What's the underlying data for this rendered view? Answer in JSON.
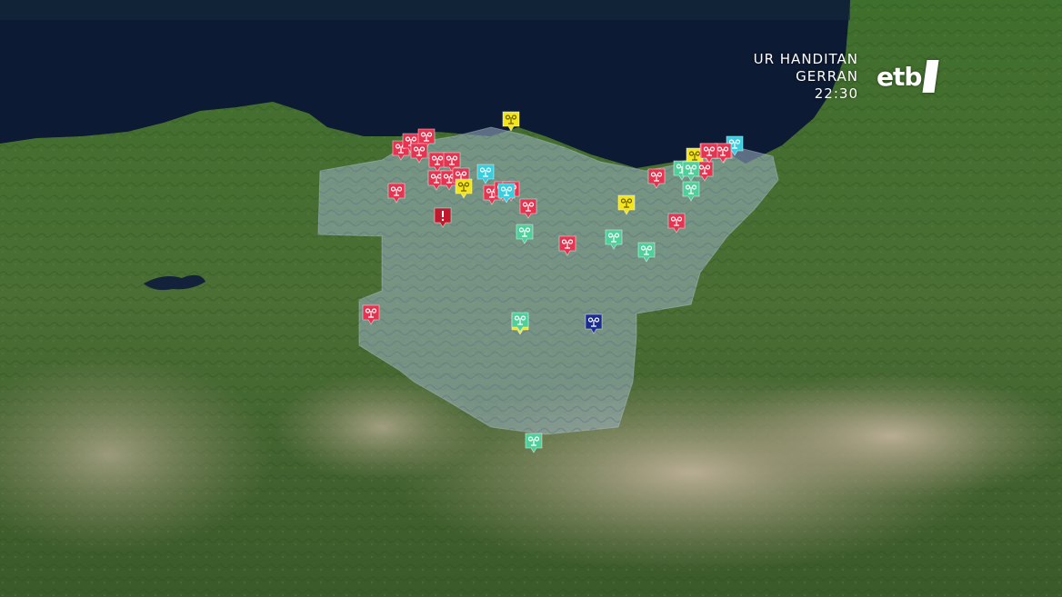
{
  "broadcast": {
    "promo_line1": "UR HANDITAN",
    "promo_line2": "GERRAN",
    "promo_time": "22:30",
    "channel_logo": "etb"
  },
  "colors": {
    "sea": "#0c1a33",
    "land_green": "#3d6b2c",
    "land_dry": "#a39a83",
    "region_overlay": "#9db4c4",
    "marker_red": "#e63350",
    "marker_darkred": "#c0182c",
    "marker_yellow": "#f2e51e",
    "marker_cyan": "#37cfe0",
    "marker_green": "#4fcf9a",
    "marker_navy": "#1a2d8f"
  },
  "markers": [
    {
      "color": "red",
      "icon": "wind-icon"
    },
    {
      "color": "red",
      "icon": "wind-icon"
    },
    {
      "color": "red",
      "icon": "wind-icon"
    },
    {
      "color": "red",
      "icon": "wind-icon"
    },
    {
      "color": "red",
      "icon": "wind-icon"
    },
    {
      "color": "red",
      "icon": "wind-icon"
    },
    {
      "color": "red",
      "icon": "wind-icon"
    },
    {
      "color": "red",
      "icon": "wind-icon"
    },
    {
      "color": "red",
      "icon": "wind-icon"
    },
    {
      "color": "red",
      "icon": "wind-icon"
    },
    {
      "color": "red",
      "icon": "wind-icon"
    },
    {
      "color": "red",
      "icon": "wind-icon"
    },
    {
      "color": "yellow",
      "icon": "wind-icon"
    },
    {
      "color": "cyan",
      "icon": "wind-icon"
    },
    {
      "color": "red",
      "icon": "wind-icon"
    },
    {
      "color": "red",
      "icon": "wind-icon"
    },
    {
      "color": "cyan",
      "icon": "wind-icon"
    },
    {
      "color": "yellow",
      "icon": "wind-icon"
    },
    {
      "color": "darkred",
      "icon": "exclamation-icon"
    },
    {
      "color": "red",
      "icon": "wind-icon"
    },
    {
      "color": "green",
      "icon": "wind-icon"
    },
    {
      "color": "red",
      "icon": "wind-icon"
    },
    {
      "color": "green",
      "icon": "wind-icon"
    },
    {
      "color": "yellow",
      "icon": "wind-icon"
    },
    {
      "color": "green",
      "icon": "wind-icon"
    },
    {
      "color": "red",
      "icon": "wind-icon"
    },
    {
      "color": "red",
      "icon": "wind-icon"
    },
    {
      "color": "green",
      "icon": "wind-icon"
    },
    {
      "color": "green",
      "icon": "wind-icon"
    },
    {
      "color": "yellow",
      "icon": "wind-icon"
    },
    {
      "color": "red",
      "icon": "wind-icon"
    },
    {
      "color": "red",
      "icon": "wind-icon"
    },
    {
      "color": "red",
      "icon": "wind-icon"
    },
    {
      "color": "cyan",
      "icon": "wind-icon"
    },
    {
      "color": "green",
      "icon": "wind-icon"
    },
    {
      "color": "red",
      "icon": "wind-icon"
    },
    {
      "color": "red",
      "icon": "wind-icon"
    },
    {
      "color": "yellow",
      "icon": "wind-icon"
    },
    {
      "color": "green",
      "icon": "wind-icon"
    },
    {
      "color": "navy",
      "icon": "wind-icon"
    },
    {
      "color": "green",
      "icon": "wind-icon"
    }
  ]
}
